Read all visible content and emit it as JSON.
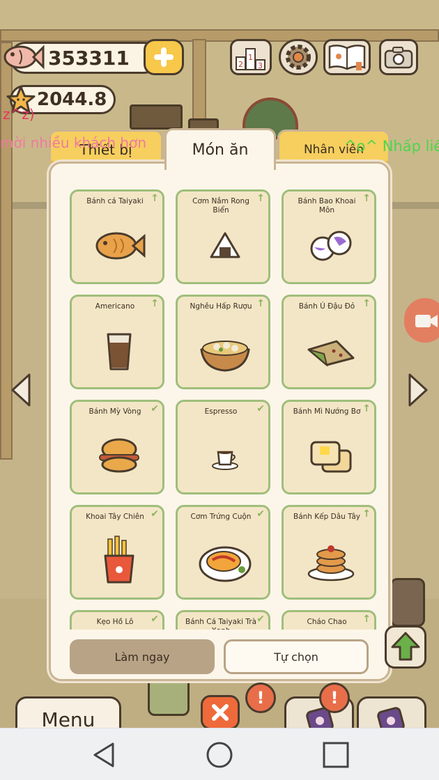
{
  "hud": {
    "fish_count": "353311",
    "star_count": "2044.8"
  },
  "marquee": {
    "left_text": "mời nhiều khách hơn",
    "left_fragment": "z^z)",
    "right_text": "^o^ Nhấp liề"
  },
  "tabs": [
    {
      "label": "Thiết bị",
      "active": false
    },
    {
      "label": "Món ăn",
      "active": true
    },
    {
      "label": "Nhân viên",
      "active": false
    }
  ],
  "menu_items": [
    {
      "label": "Bánh cá Taiyaki",
      "status": "upgrade",
      "icon": "taiyaki-fish-cake-icon"
    },
    {
      "label": "Cơm Nắm Rong Biển",
      "status": "upgrade",
      "icon": "rice-ball-icon"
    },
    {
      "label": "Bánh Bao Khoai Môn",
      "status": "upgrade",
      "icon": "taro-bun-icon"
    },
    {
      "label": "Americano",
      "status": "upgrade",
      "icon": "iced-coffee-icon"
    },
    {
      "label": "Nghêu Hấp Rượu",
      "status": "upgrade",
      "icon": "steamed-clams-icon"
    },
    {
      "label": "Bánh Ú Đậu Đỏ",
      "status": "upgrade",
      "icon": "red-bean-dumpling-icon"
    },
    {
      "label": "Bánh Mỳ Vòng",
      "status": "done",
      "icon": "bagel-sandwich-icon"
    },
    {
      "label": "Espresso",
      "status": "done",
      "icon": "espresso-cup-icon"
    },
    {
      "label": "Bánh Mì Nướng Bơ",
      "status": "upgrade",
      "icon": "butter-toast-icon"
    },
    {
      "label": "Khoai Tây Chiên",
      "status": "done",
      "icon": "french-fries-icon"
    },
    {
      "label": "Cơm Trứng Cuộn",
      "status": "done",
      "icon": "omurice-icon"
    },
    {
      "label": "Bánh Kếp Dâu Tây",
      "status": "upgrade",
      "icon": "strawberry-pancake-icon"
    },
    {
      "label": "Kẹo Hồ Lô",
      "status": "done",
      "icon": "candied-fruit-icon"
    },
    {
      "label": "Bánh Cá Taiyaki Trà Xanh",
      "status": "done",
      "icon": "matcha-taiyaki-icon"
    },
    {
      "label": "Cháo Chao",
      "status": "upgrade",
      "icon": "porridge-icon"
    }
  ],
  "marks": {
    "upgrade": "↑",
    "done": "✔"
  },
  "actions": {
    "make_now": "Làm ngay",
    "custom": "Tự chọn"
  },
  "bottom_bar": {
    "menu_label": "Menu",
    "alert_symbol": "!"
  },
  "colors": {
    "card_border": "#9fbe7b",
    "tab_inactive": "#f6cf5e",
    "close_button": "#ef6a3a"
  }
}
